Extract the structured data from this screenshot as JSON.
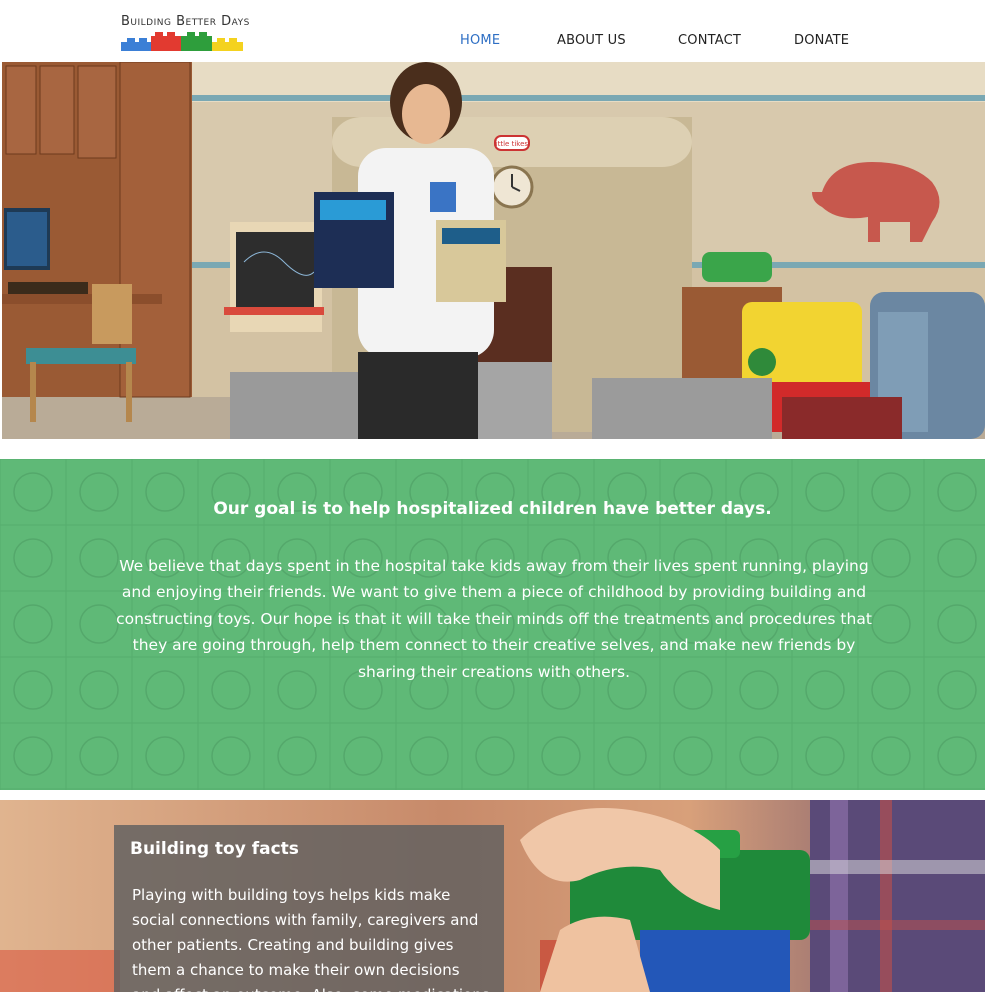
{
  "header": {
    "logo_text": "Building Better Days",
    "nav": [
      {
        "label": "HOME",
        "active": true
      },
      {
        "label": "ABOUT US",
        "active": false
      },
      {
        "label": "CONTACT",
        "active": false
      },
      {
        "label": "DONATE",
        "active": false
      }
    ]
  },
  "hero": {
    "image_label": "little tikes."
  },
  "mission": {
    "title": "Our goal is to help hospitalized children have better days.",
    "body": "We believe that days spent in the hospital take kids away from their lives spent running, playing and enjoying their friends. We want to give them a piece of childhood by providing building and constructing toys. Our hope is that it will take their minds off the treatments and procedures that they are going through, help them connect to their creative selves, and make new friends by sharing their creations with others."
  },
  "facts": {
    "title": "Building toy facts",
    "body": "Playing with building toys helps kids make social connections with family, caregivers and other patients. Creating and building gives them a chance to make their own decisions and affect an outcome. Also, some medications may affect"
  },
  "colors": {
    "accent": "#2e6fc4",
    "mission_green": "#5fb977",
    "brick_blue": "#3b7fd6",
    "brick_red": "#e23a30",
    "brick_green": "#2e9e3c",
    "brick_yellow": "#f4d21f"
  }
}
